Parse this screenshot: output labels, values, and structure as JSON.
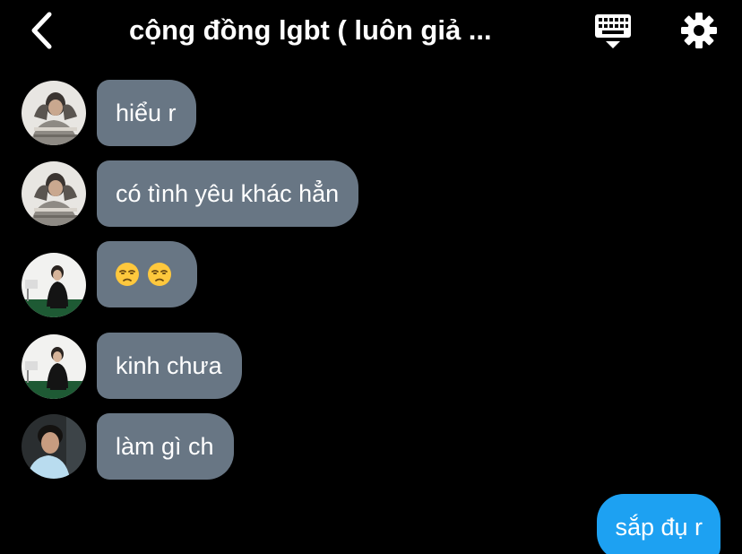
{
  "header": {
    "title": "cộng đồng lgbt ( luôn giả ...",
    "back_icon": "chevron-left-icon",
    "keyboard_icon": "keyboard-icon",
    "settings_icon": "gear-icon"
  },
  "messages": [
    {
      "sender": "incoming",
      "avatar": "avatar-user-a",
      "text": "hiểu r"
    },
    {
      "sender": "incoming",
      "avatar": "avatar-user-a",
      "text": "có tình yêu khác hẳn"
    },
    {
      "sender": "incoming",
      "avatar": "avatar-user-b",
      "text": "",
      "emojis": [
        "unamused-face-emoji",
        "unamused-face-emoji"
      ]
    },
    {
      "sender": "incoming",
      "avatar": "avatar-user-b",
      "text": "kinh chưa"
    },
    {
      "sender": "incoming",
      "avatar": "avatar-user-c",
      "text": "làm gì ch"
    },
    {
      "sender": "outgoing",
      "text": "sắp đụ r"
    }
  ],
  "colors": {
    "background": "#000000",
    "incoming_bubble": "#687684",
    "outgoing_bubble": "#1da1f2",
    "text": "#ffffff"
  }
}
